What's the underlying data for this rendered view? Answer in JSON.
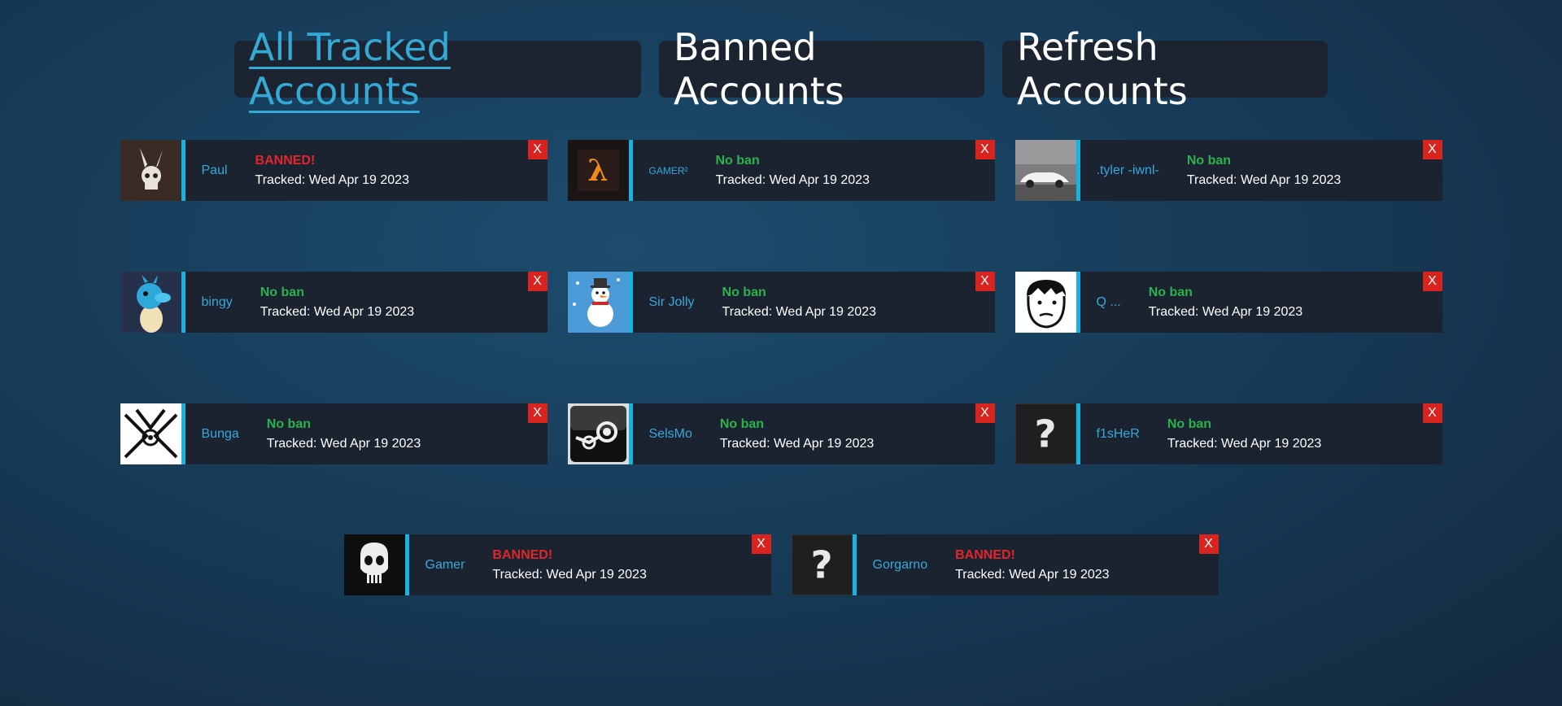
{
  "nav": {
    "all_label": "All Tracked Accounts",
    "banned_label": "Banned Accounts",
    "refresh_label": "Refresh Accounts"
  },
  "tracked_prefix": "Tracked:",
  "accounts": [
    {
      "name": "Paul",
      "status": "BANNED!",
      "tracked": "Tracked: Wed Apr 19 2023",
      "close": "X"
    },
    {
      "name": "GAMER²",
      "status": "No ban",
      "tracked": "Tracked: Wed Apr 19 2023",
      "close": "X"
    },
    {
      "name": ".tyler -iwnl-",
      "status": "No ban",
      "tracked": "Tracked: Wed Apr 19 2023",
      "close": "X"
    },
    {
      "name": "bingy",
      "status": "No ban",
      "tracked": "Tracked: Wed Apr 19 2023",
      "close": "X"
    },
    {
      "name": "Sir Jolly",
      "status": "No ban",
      "tracked": "Tracked: Wed Apr 19 2023",
      "close": "X"
    },
    {
      "name": "Q ...",
      "status": "No ban",
      "tracked": "Tracked: Wed Apr 19 2023",
      "close": "X"
    },
    {
      "name": "Bunga",
      "status": "No ban",
      "tracked": "Tracked: Wed Apr 19 2023",
      "close": "X"
    },
    {
      "name": "SelsMo",
      "status": "No ban",
      "tracked": "Tracked: Wed Apr 19 2023",
      "close": "X"
    },
    {
      "name": "f1sHeR",
      "status": "No ban",
      "tracked": "Tracked: Wed Apr 19 2023",
      "close": "X"
    },
    {
      "name": "Gamer",
      "status": "BANNED!",
      "tracked": "Tracked: Wed Apr 19 2023",
      "close": "X"
    },
    {
      "name": "Gorgarno",
      "status": "BANNED!",
      "tracked": "Tracked: Wed Apr 19 2023",
      "close": "X"
    }
  ],
  "colors": {
    "accent": "#17b3e0",
    "banned": "#e0262b",
    "ok": "#2bb24c",
    "close": "#d9231f"
  },
  "avatar_icons": [
    "skull-bunny-avatar-icon",
    "lambda-avatar-icon",
    "car-photo-avatar-icon",
    "blue-duck-avatar-icon",
    "snowman-avatar-icon",
    "sketch-face-avatar-icon",
    "emblem-avatar-icon",
    "steam-logo-avatar-icon",
    "question-mark-avatar-icon",
    "punisher-skull-avatar-icon",
    "question-mark-avatar-icon"
  ]
}
